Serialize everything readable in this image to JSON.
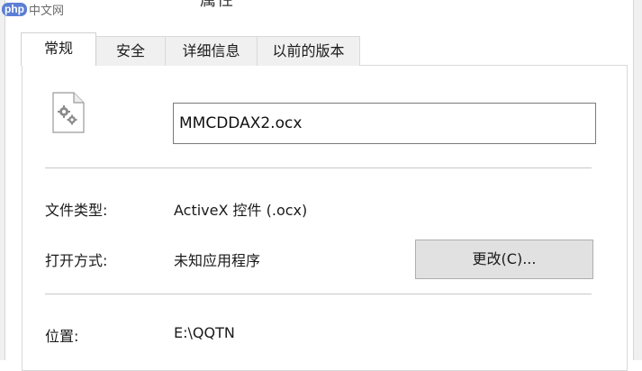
{
  "window": {
    "title_fragment": "属性"
  },
  "watermark": {
    "brand_tag": "php",
    "brand_text": "中文网"
  },
  "tabs": [
    {
      "label": "常规",
      "active": true
    },
    {
      "label": "安全",
      "active": false
    },
    {
      "label": "详细信息",
      "active": false
    },
    {
      "label": "以前的版本",
      "active": false
    }
  ],
  "general": {
    "file_icon": "settings-file-icon",
    "file_name": "MMCDDAX2.ocx",
    "file_type_label": "文件类型:",
    "file_type_value": "ActiveX 控件 (.ocx)",
    "opens_with_label": "打开方式:",
    "opens_with_value": "未知应用程序",
    "change_button_label": "更改(C)...",
    "location_label": "位置:",
    "location_value": "E:\\QQTN"
  },
  "colors": {
    "button_face": "#e1e1e1",
    "panel_border": "#d9d9d9",
    "brand_blue": "#5b7fd4"
  }
}
